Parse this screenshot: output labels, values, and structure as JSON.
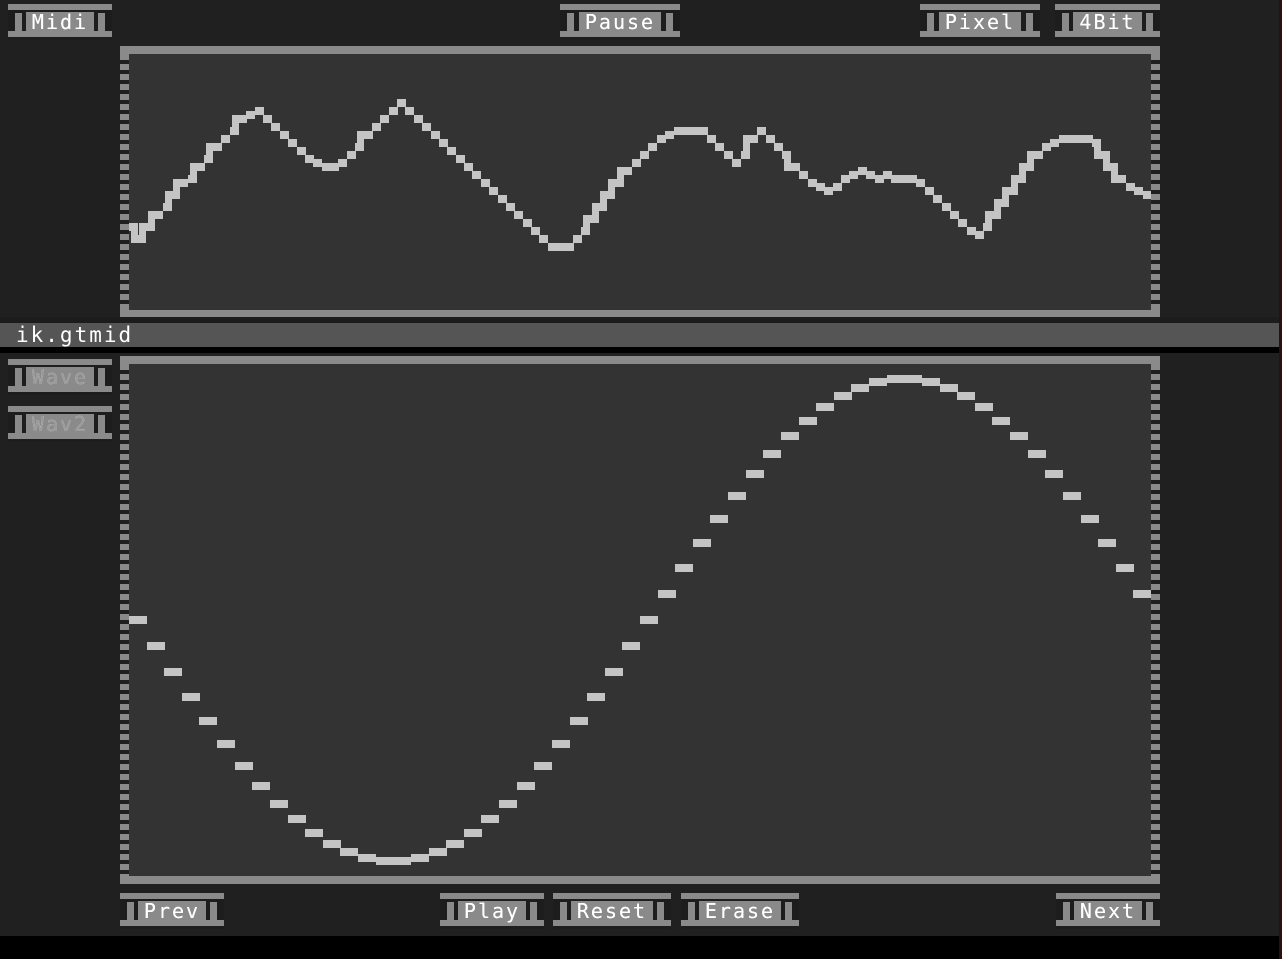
{
  "app": {
    "background_color": "#202020",
    "panel_color": "#333333",
    "accent_color": "#8a8a8a",
    "wave_color": "#c4c4c4",
    "text_color": "#ffffff"
  },
  "toolbar": {
    "midi_label": "Midi",
    "pause_label": "Pause",
    "pixel_label": "Pixel",
    "bit_label": "4Bit"
  },
  "filename": {
    "value": "ik.gtmid"
  },
  "sidebar": {
    "items": [
      {
        "label": "Wave",
        "state": "inactive"
      },
      {
        "label": "Wav2",
        "state": "inactive"
      }
    ]
  },
  "transport": {
    "prev_label": "Prev",
    "play_label": "Play",
    "reset_label": "Reset",
    "erase_label": "Erase",
    "next_label": "Next"
  },
  "chart_data": [
    {
      "id": "top-scope",
      "type": "line",
      "title": "",
      "xlabel": "",
      "ylabel": "",
      "render": "stepped-blocks",
      "block_width": 13,
      "block_height": 8,
      "ylim": [
        0,
        264
      ],
      "note": "MIDI note/amplitude trace, y in panel pixels from panel top",
      "values": [
        168,
        180,
        168,
        156,
        148,
        136,
        124,
        120,
        108,
        100,
        88,
        80,
        72,
        60,
        56,
        52,
        60,
        68,
        76,
        84,
        92,
        100,
        104,
        108,
        108,
        104,
        96,
        88,
        76,
        68,
        60,
        52,
        44,
        52,
        60,
        68,
        76,
        84,
        92,
        100,
        108,
        116,
        124,
        132,
        140,
        148,
        156,
        164,
        172,
        180,
        188,
        188,
        188,
        180,
        172,
        160,
        148,
        136,
        124,
        112,
        104,
        96,
        88,
        80,
        76,
        72,
        72,
        72,
        72,
        80,
        88,
        96,
        104,
        96,
        80,
        72,
        80,
        88,
        96,
        108,
        116,
        124,
        128,
        132,
        128,
        120,
        116,
        112,
        116,
        120,
        116,
        120,
        120,
        120,
        124,
        132,
        140,
        148,
        156,
        164,
        172,
        176,
        168,
        156,
        144,
        132,
        120,
        108,
        96,
        88,
        84,
        80,
        80,
        80,
        80,
        84,
        96,
        108,
        120,
        128,
        132,
        136
      ]
    },
    {
      "id": "bottom-scope",
      "type": "line",
      "title": "",
      "xlabel": "",
      "ylabel": "",
      "render": "dashed-sine",
      "waveform": "sine",
      "cycles": 1,
      "phase_deg": 180,
      "amplitude": 1.0,
      "block_width": 18,
      "block_height": 8,
      "ylim": [
        0,
        520
      ],
      "note": "single sine cycle; starts near mid-left descending, trough at ~x 30%, crest at ~x 72%",
      "points": 58
    }
  ]
}
